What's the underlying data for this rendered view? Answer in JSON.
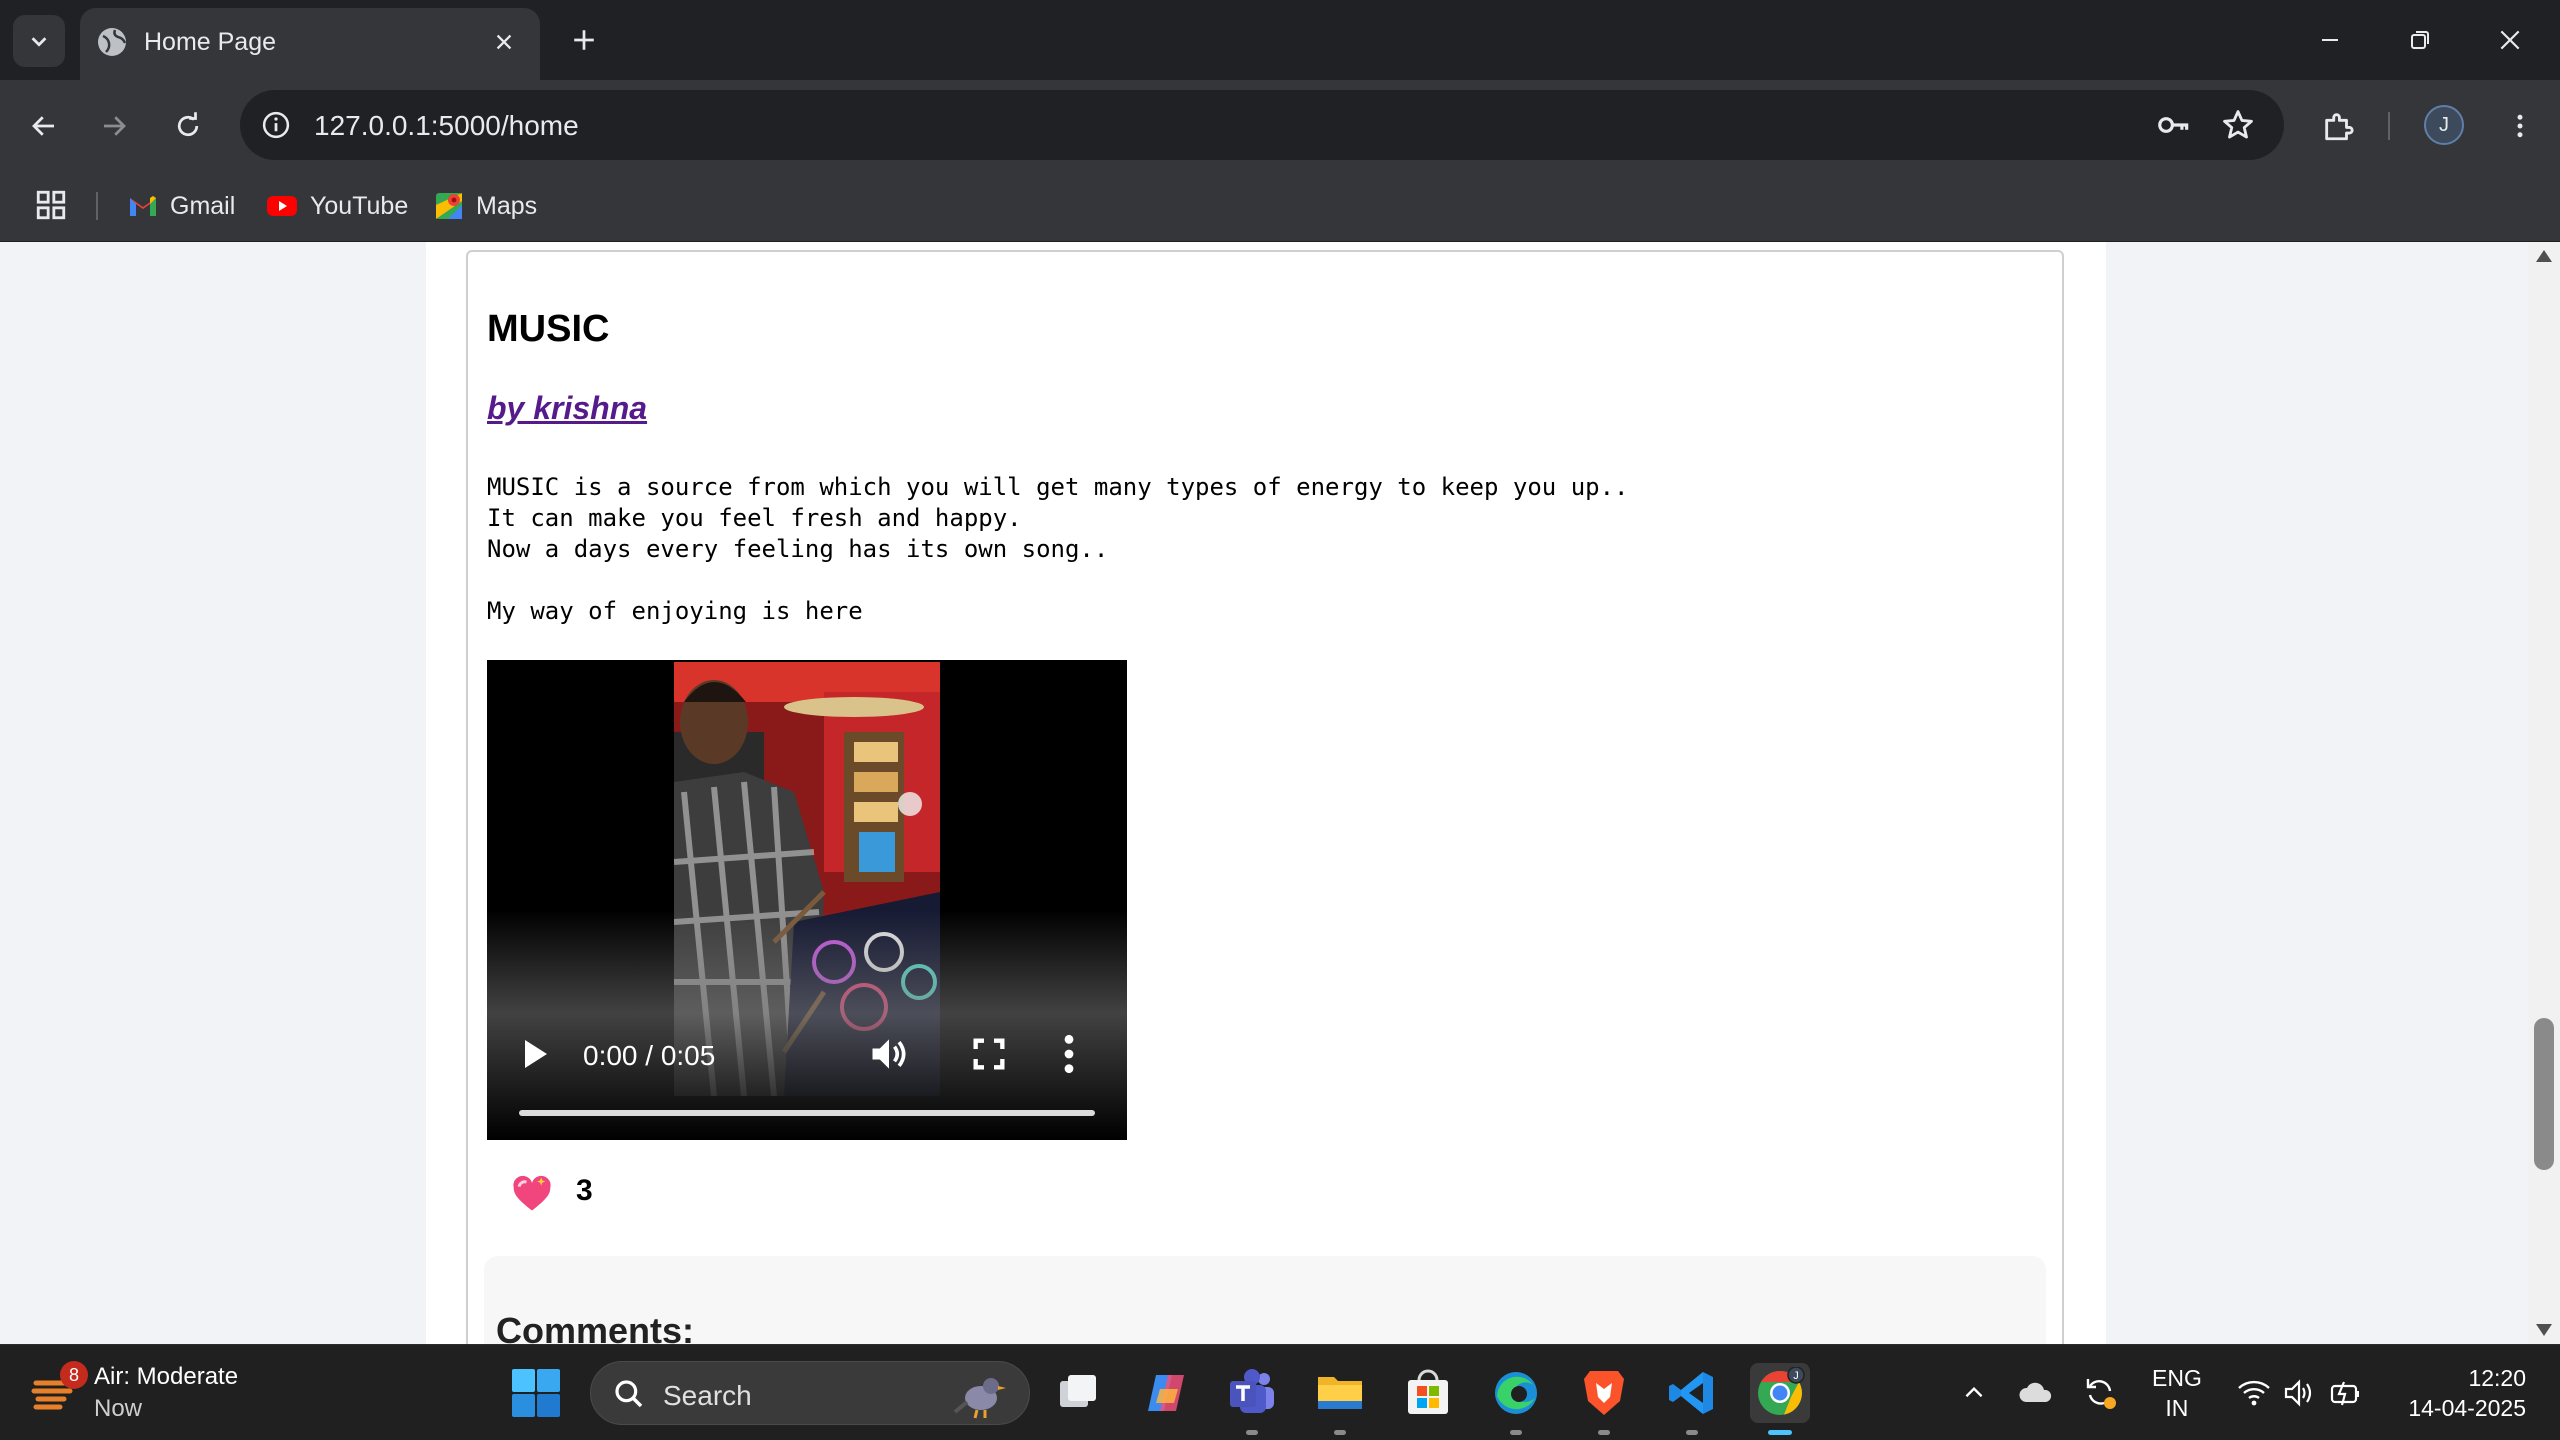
{
  "browser": {
    "tab": {
      "title": "Home Page"
    },
    "address": {
      "url": "127.0.0.1:5000/home"
    },
    "profile_initial": "J",
    "bookmarks": [
      {
        "label": "Gmail"
      },
      {
        "label": "YouTube"
      },
      {
        "label": "Maps"
      }
    ]
  },
  "post": {
    "title": "MUSIC",
    "author": "by krishna",
    "body": "MUSIC is a source from which you will get many types of energy to keep you up..\nIt can make you feel fresh and happy.\nNow a days every feeling has its own song..\n\nMy way of enjoying is here",
    "video": {
      "time": "0:00 / 0:05",
      "progress": 0.0
    },
    "likes": "3"
  },
  "comments": {
    "title": "Comments:"
  },
  "taskbar": {
    "weather": {
      "badge": "8",
      "line1": "Air: Moderate",
      "line2": "Now"
    },
    "search_label": "Search",
    "language": {
      "line1": "ENG",
      "line2": "IN"
    },
    "clock": {
      "time": "12:20",
      "date": "14-04-2025"
    },
    "chrome_badge": "J"
  }
}
